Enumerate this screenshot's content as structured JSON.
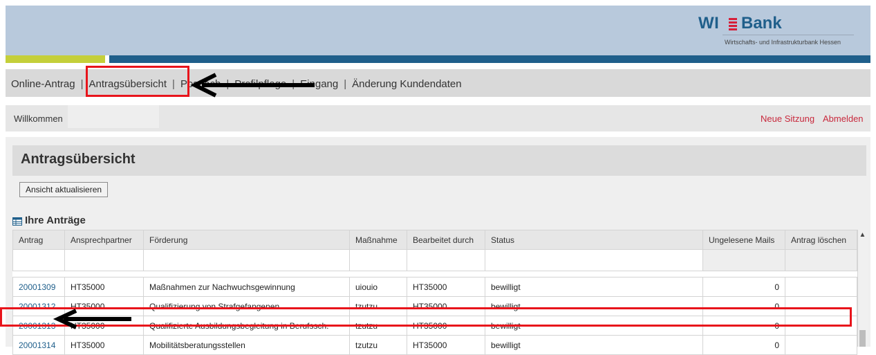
{
  "logo": {
    "wi": "WI",
    "bank": "Bank",
    "subtitle": "Wirtschafts- und Infrastrukturbank Hessen"
  },
  "nav": {
    "items": [
      {
        "label": "Online-Antrag"
      },
      {
        "label": "Antragsübersicht"
      },
      {
        "label": "Postfach"
      },
      {
        "label": "Profilpflege"
      },
      {
        "label": "Eingang"
      },
      {
        "label": "Änderung Kundendaten"
      }
    ]
  },
  "welcome": {
    "label": "Willkommen",
    "neue_sitzung": "Neue Sitzung",
    "abmelden": "Abmelden"
  },
  "page": {
    "title": "Antragsübersicht",
    "refresh_button": "Ansicht aktualisieren",
    "section_title": "Ihre Anträge"
  },
  "table": {
    "headers": [
      "Antrag",
      "Ansprechpartner",
      "Förderung",
      "Maßnahme",
      "Bearbeitet durch",
      "Status",
      "Ungelesene Mails",
      "Antrag löschen"
    ],
    "rows": [
      {
        "antrag": "20001309",
        "partner": "HT35000",
        "foerderung": "Maßnahmen zur Nachwuchsgewinnung",
        "massnahme": "uiouio",
        "bearbeitet": "HT35000",
        "status": "bewilligt",
        "mails": "0"
      },
      {
        "antrag": "20001312",
        "partner": "HT35000",
        "foerderung": "Qualifizierung von Strafgefangenen",
        "massnahme": "tzutzu",
        "bearbeitet": "HT35000",
        "status": "bewilligt",
        "mails": "0"
      },
      {
        "antrag": "20001313",
        "partner": "HT35000",
        "foerderung": "Qualifizierte Ausbildungsbegleitung in Berufssch.",
        "massnahme": "tzutzu",
        "bearbeitet": "HT35000",
        "status": "bewilligt",
        "mails": "0"
      },
      {
        "antrag": "20001314",
        "partner": "HT35000",
        "foerderung": "Mobilitätsberatungsstellen",
        "massnahme": "tzutzu",
        "bearbeitet": "HT35000",
        "status": "bewilligt",
        "mails": "0"
      }
    ]
  },
  "colors": {
    "banner": "#b8c9dc",
    "accent_green": "#c4cf3a",
    "accent_blue": "#1f5f8b",
    "link_red": "#c8283c",
    "annotation_red": "#e8141b"
  }
}
